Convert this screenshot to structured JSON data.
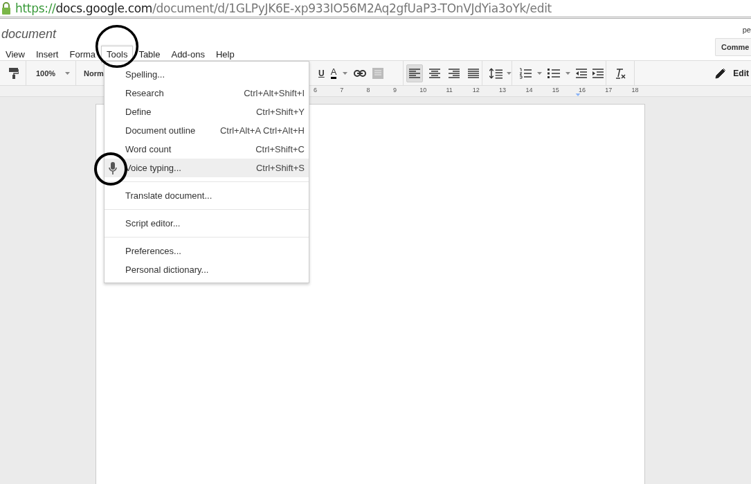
{
  "browser": {
    "url_scheme": "https://",
    "url_host": "docs.google.com",
    "url_path": "/document/d/1GLPyJK6E-xp933IO56M2Aq2gfUaP3-TOnVJdYia3oYk/edit"
  },
  "document_title": "document",
  "account_label": "pe",
  "comment_button": "Comme",
  "menu_bar": [
    {
      "label": "View",
      "selected": false
    },
    {
      "label": "Insert",
      "selected": false
    },
    {
      "label": "Forma",
      "selected": false
    },
    {
      "label": "Tools",
      "selected": true
    },
    {
      "label": "Table",
      "selected": false
    },
    {
      "label": "Add-ons",
      "selected": false
    },
    {
      "label": "Help",
      "selected": false
    }
  ],
  "toolbar": {
    "zoom": "100%",
    "style": "Norm",
    "underline": "U",
    "text_color": "A",
    "align": [
      {
        "kind": "left",
        "selected": true
      },
      {
        "kind": "center",
        "selected": false
      },
      {
        "kind": "right",
        "selected": false
      },
      {
        "kind": "justify",
        "selected": false
      }
    ],
    "mode": "Edit"
  },
  "ruler": [
    "6",
    "7",
    "8",
    "9",
    "10",
    "11",
    "12",
    "13",
    "14",
    "15",
    "16",
    "17",
    "18"
  ],
  "tools_menu": [
    [
      {
        "label": "Spelling...",
        "kind": "plain",
        "selected": false
      },
      {
        "label": "Research",
        "shortcut": "Ctrl+Alt+Shift+I",
        "kind": "plain",
        "selected": false
      },
      {
        "label": "Define",
        "shortcut": "Ctrl+Shift+Y",
        "kind": "plain",
        "selected": false
      },
      {
        "label": "Document outline",
        "shortcut": "Ctrl+Alt+A Ctrl+Alt+H",
        "kind": "plain",
        "selected": false
      },
      {
        "label": "Word count",
        "shortcut": "Ctrl+Shift+C",
        "kind": "plain",
        "selected": false
      },
      {
        "label": "Voice typing...",
        "shortcut": "Ctrl+Shift+S",
        "kind": "mic",
        "selected": true
      }
    ],
    [
      {
        "label": "Translate document...",
        "kind": "plain",
        "selected": false
      }
    ],
    [
      {
        "label": "Script editor...",
        "kind": "plain",
        "selected": false
      }
    ],
    [
      {
        "label": "Preferences...",
        "kind": "plain",
        "selected": false
      },
      {
        "label": "Personal dictionary...",
        "kind": "plain",
        "selected": false
      }
    ]
  ]
}
